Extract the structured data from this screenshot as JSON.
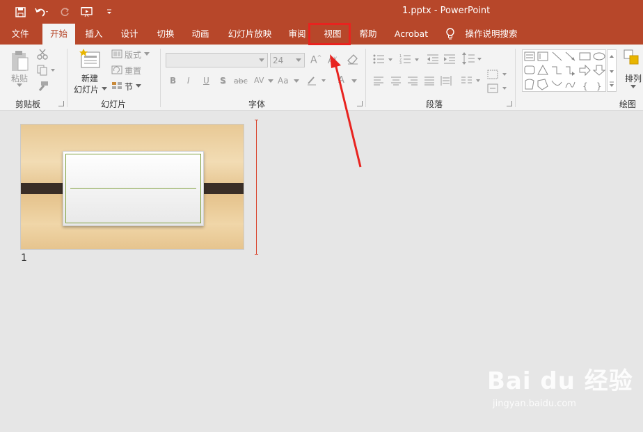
{
  "window": {
    "title": "1.pptx  -  PowerPoint"
  },
  "tabs": [
    {
      "label": "文件"
    },
    {
      "label": "开始"
    },
    {
      "label": "插入"
    },
    {
      "label": "设计"
    },
    {
      "label": "切换"
    },
    {
      "label": "动画"
    },
    {
      "label": "幻灯片放映"
    },
    {
      "label": "审阅"
    },
    {
      "label": "视图"
    },
    {
      "label": "帮助"
    },
    {
      "label": "Acrobat"
    },
    {
      "label": "操作说明搜索"
    }
  ],
  "ribbon": {
    "clipboard": {
      "paste_label": "粘贴",
      "group_label": "剪贴板"
    },
    "slides": {
      "new_slide_line1": "新建",
      "new_slide_line2": "幻灯片",
      "layout_label": "版式",
      "reset_label": "重置",
      "section_label": "节",
      "group_label": "幻灯片"
    },
    "font": {
      "font_name": "",
      "font_size": "24",
      "group_label": "字体",
      "bold": "B",
      "italic": "I",
      "underline": "U",
      "shadow": "S",
      "strike": "abc",
      "spacing": "AV",
      "case": "Aa"
    },
    "paragraph": {
      "group_label": "段落"
    },
    "drawing": {
      "arrange_label": "排列",
      "group_label": "绘图"
    }
  },
  "slides_panel": {
    "slide_number": "1"
  },
  "watermark": {
    "brand": "Bai  du 经验",
    "url": "jingyan.baidu.com"
  },
  "colors": {
    "accent": "#b7472a",
    "highlight": "#e8231f"
  }
}
